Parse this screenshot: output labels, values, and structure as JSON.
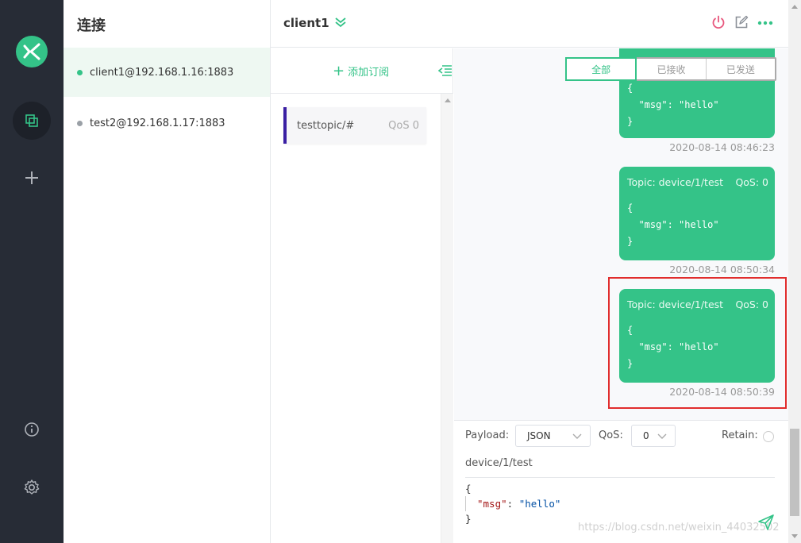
{
  "sidebar": {
    "icons": [
      "logo-icon",
      "connections-icon",
      "add-icon",
      "info-icon",
      "settings-icon"
    ]
  },
  "connections": {
    "title": "连接",
    "items": [
      {
        "label": "client1@192.168.1.16:1883",
        "status_color": "#34c388",
        "active": true
      },
      {
        "label": "test2@192.168.1.17:1883",
        "status_color": "#9aa0a6",
        "active": false
      }
    ]
  },
  "header": {
    "client_name": "client1",
    "actions": [
      "power-icon",
      "edit-icon",
      "more-icon"
    ]
  },
  "subscriptions": {
    "add_label": "添加订阅",
    "items": [
      {
        "topic": "testtopic/#",
        "qos": "QoS 0",
        "color": "#3a1fa3"
      }
    ]
  },
  "messages": {
    "filters": [
      "全部",
      "已接收",
      "已发送"
    ],
    "active_filter": "全部",
    "list": [
      {
        "topic": "",
        "qos": "",
        "payload": "{\n  \"msg\": \"hello\"\n}",
        "time": "2020-08-14 08:46:23"
      },
      {
        "topic": "Topic: device/1/test",
        "qos": "QoS: 0",
        "payload": "{\n  \"msg\": \"hello\"\n}",
        "time": "2020-08-14 08:50:34"
      },
      {
        "topic": "Topic: device/1/test",
        "qos": "QoS: 0",
        "payload": "{\n  \"msg\": \"hello\"\n}",
        "time": "2020-08-14 08:50:39"
      }
    ]
  },
  "publish": {
    "payload_label": "Payload:",
    "payload_format": "JSON",
    "qos_label": "QoS:",
    "qos_value": "0",
    "retain_label": "Retain:",
    "topic": "device/1/test",
    "payload_lines": [
      "{",
      "\"msg\"",
      "\"hello\"",
      "}"
    ],
    "watermark": "https://blog.csdn.net/weixin_44032502"
  },
  "colors": {
    "accent": "#34c388",
    "nav_bg": "#272c36",
    "highlight": "#e12d2d"
  }
}
